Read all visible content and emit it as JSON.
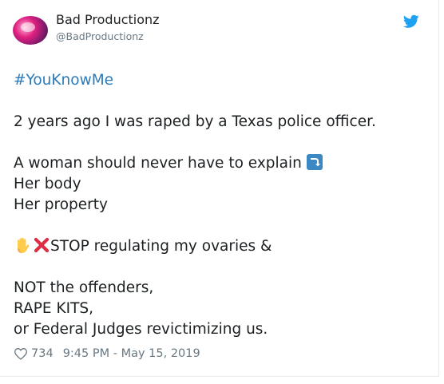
{
  "author": {
    "name": "Bad Productionz",
    "handle": "@BadProductionz"
  },
  "tweet": {
    "hashtag": "#YouKnowMe",
    "line1": "2 years ago I was raped by a Texas police officer.",
    "line2": "A woman should never have to explain",
    "line3": "Her body",
    "line4": "Her property",
    "line5": "STOP regulating my ovaries &",
    "line6": "NOT the offenders,",
    "line7": "RAPE KITS,",
    "line8": "or Federal Judges revictimizing us."
  },
  "footer": {
    "likes": "734",
    "timestamp": "9:45 PM - May 15, 2019"
  },
  "icons": {
    "brand": "twitter-bird-icon",
    "like": "heart-icon",
    "arrow": "arrow-curving-down-icon",
    "hand": "raised-hand-icon",
    "cross": "cross-mark-icon"
  },
  "colors": {
    "link": "#2b7bb9",
    "muted": "#697882",
    "brand": "#1da1f2"
  }
}
